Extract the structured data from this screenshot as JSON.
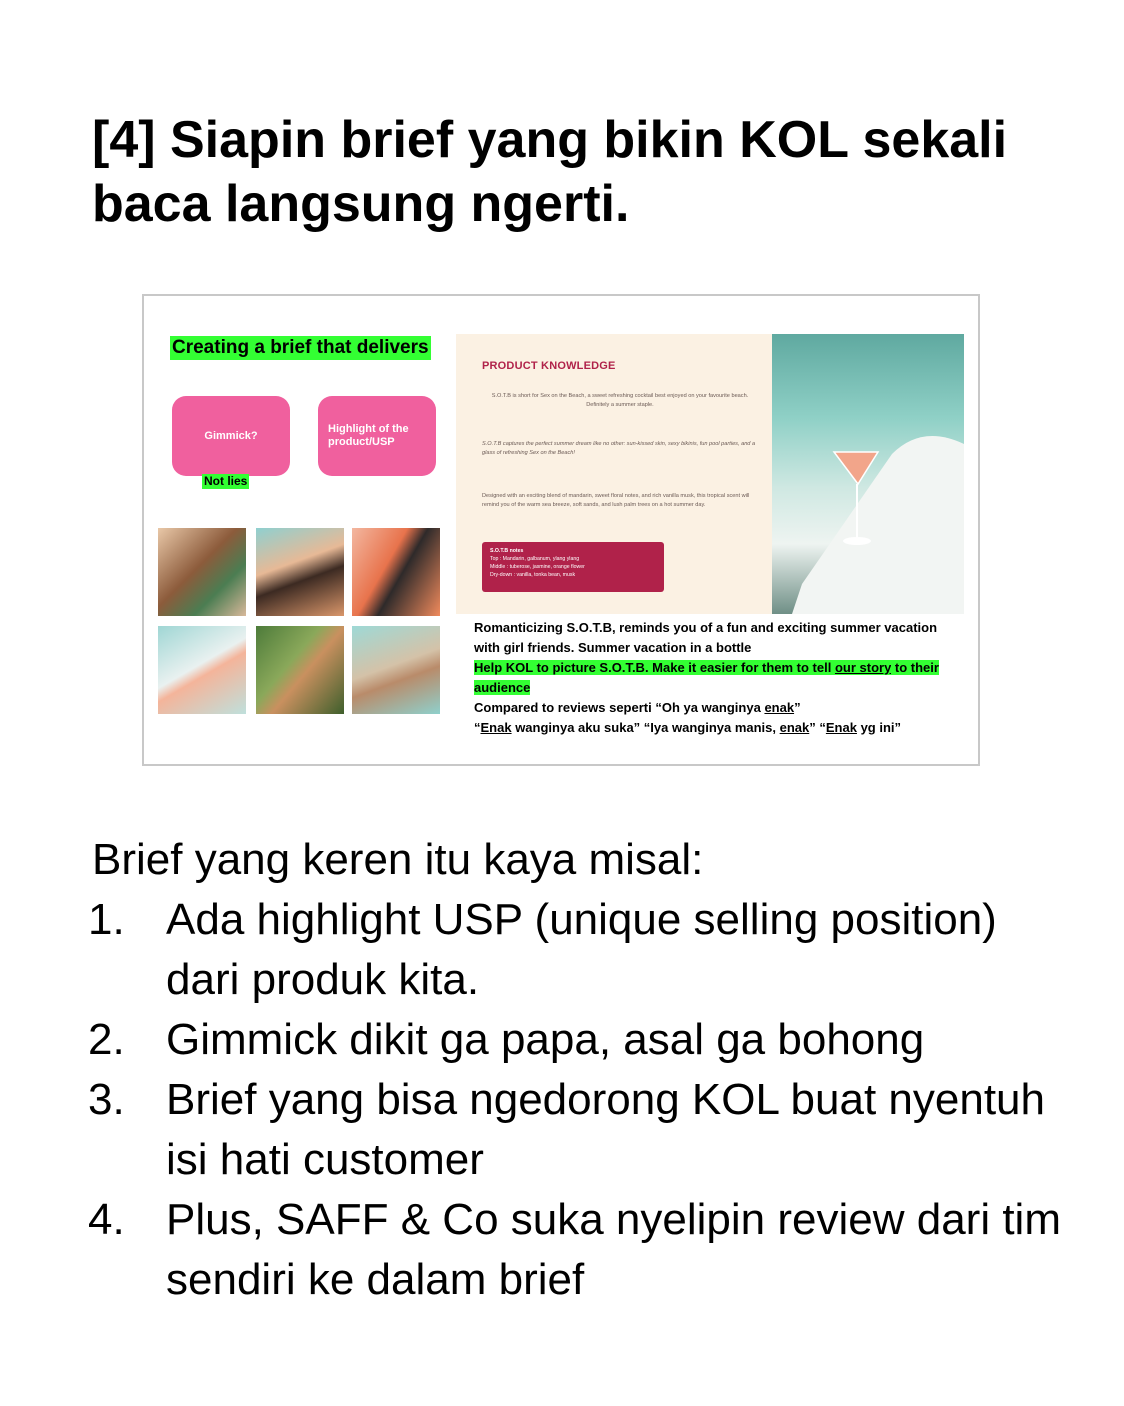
{
  "heading": "[4] Siapin brief yang bikin KOL sekali baca langsung ngerti.",
  "slide": {
    "title": "Creating a brief that delivers",
    "pills": [
      "Gimmick?",
      "Highlight of the product/USP"
    ],
    "not_lies": "Not lies",
    "product_knowledge": {
      "title": "PRODUCT KNOWLEDGE",
      "p1": "S.O.T.B is short for Sex on the Beach, a sweet refreshing cocktail best enjoyed on your favourite beach. Definitely a summer staple.",
      "p2": "S.O.T.B captures the perfect summer dream like no other: sun-kissed skin, sexy bikinis, fun pool parties, and a glass of refreshing Sex on the Beach!",
      "p3": "Designed with an exciting blend of mandarin, sweet floral notes, and rich vanilla musk, this tropical scent will remind you of the warm sea breeze, soft sands, and lush palm trees on a hot summer day.",
      "notes_title": "S.O.T.B notes",
      "notes": [
        "Top        : Mandarin, galbanum, ylang ylang",
        "Middle    : tuberose, jasmine, orange flower",
        "Dry-down : vanilla, tonka bean, musk"
      ]
    },
    "caption": {
      "line1": "Romanticizing S.O.T.B, reminds you of a fun and exciting summer vacation with girl friends. Summer vacation in a bottle",
      "hl_a": "Help KOL to picture S.O.T.B. Make it easier for them to tell ",
      "hl_b": "our story",
      "hl_c": " to their audience",
      "l3a": "Compared to reviews seperti “Oh ya wanginya ",
      "l3b": "enak",
      "l3c": "”",
      "l4a": "“",
      "l4b": "Enak",
      "l4c": " wanginya aku suka” “Iya wanginya manis, ",
      "l4d": "enak",
      "l4e": "” “",
      "l4f": "Enak",
      "l4g": " yg ini”"
    }
  },
  "body": {
    "intro": "Brief yang keren itu kaya misal:",
    "items": [
      {
        "num": "1.",
        "text": "Ada highlight USP (unique selling position) dari produk kita."
      },
      {
        "num": "2.",
        "text": "Gimmick dikit ga papa, asal ga bohong"
      },
      {
        "num": "3.",
        "text": "Brief yang bisa ngedorong KOL buat nyentuh isi hati customer"
      },
      {
        "num": "4.",
        "text": "Plus, SAFF & Co suka nyelipin review dari tim sendiri ke dalam brief"
      }
    ]
  },
  "colors": {
    "highlight": "#33ff33",
    "pill": "#f0609e",
    "brand": "#b0224a",
    "panel": "#fbf1e3"
  }
}
